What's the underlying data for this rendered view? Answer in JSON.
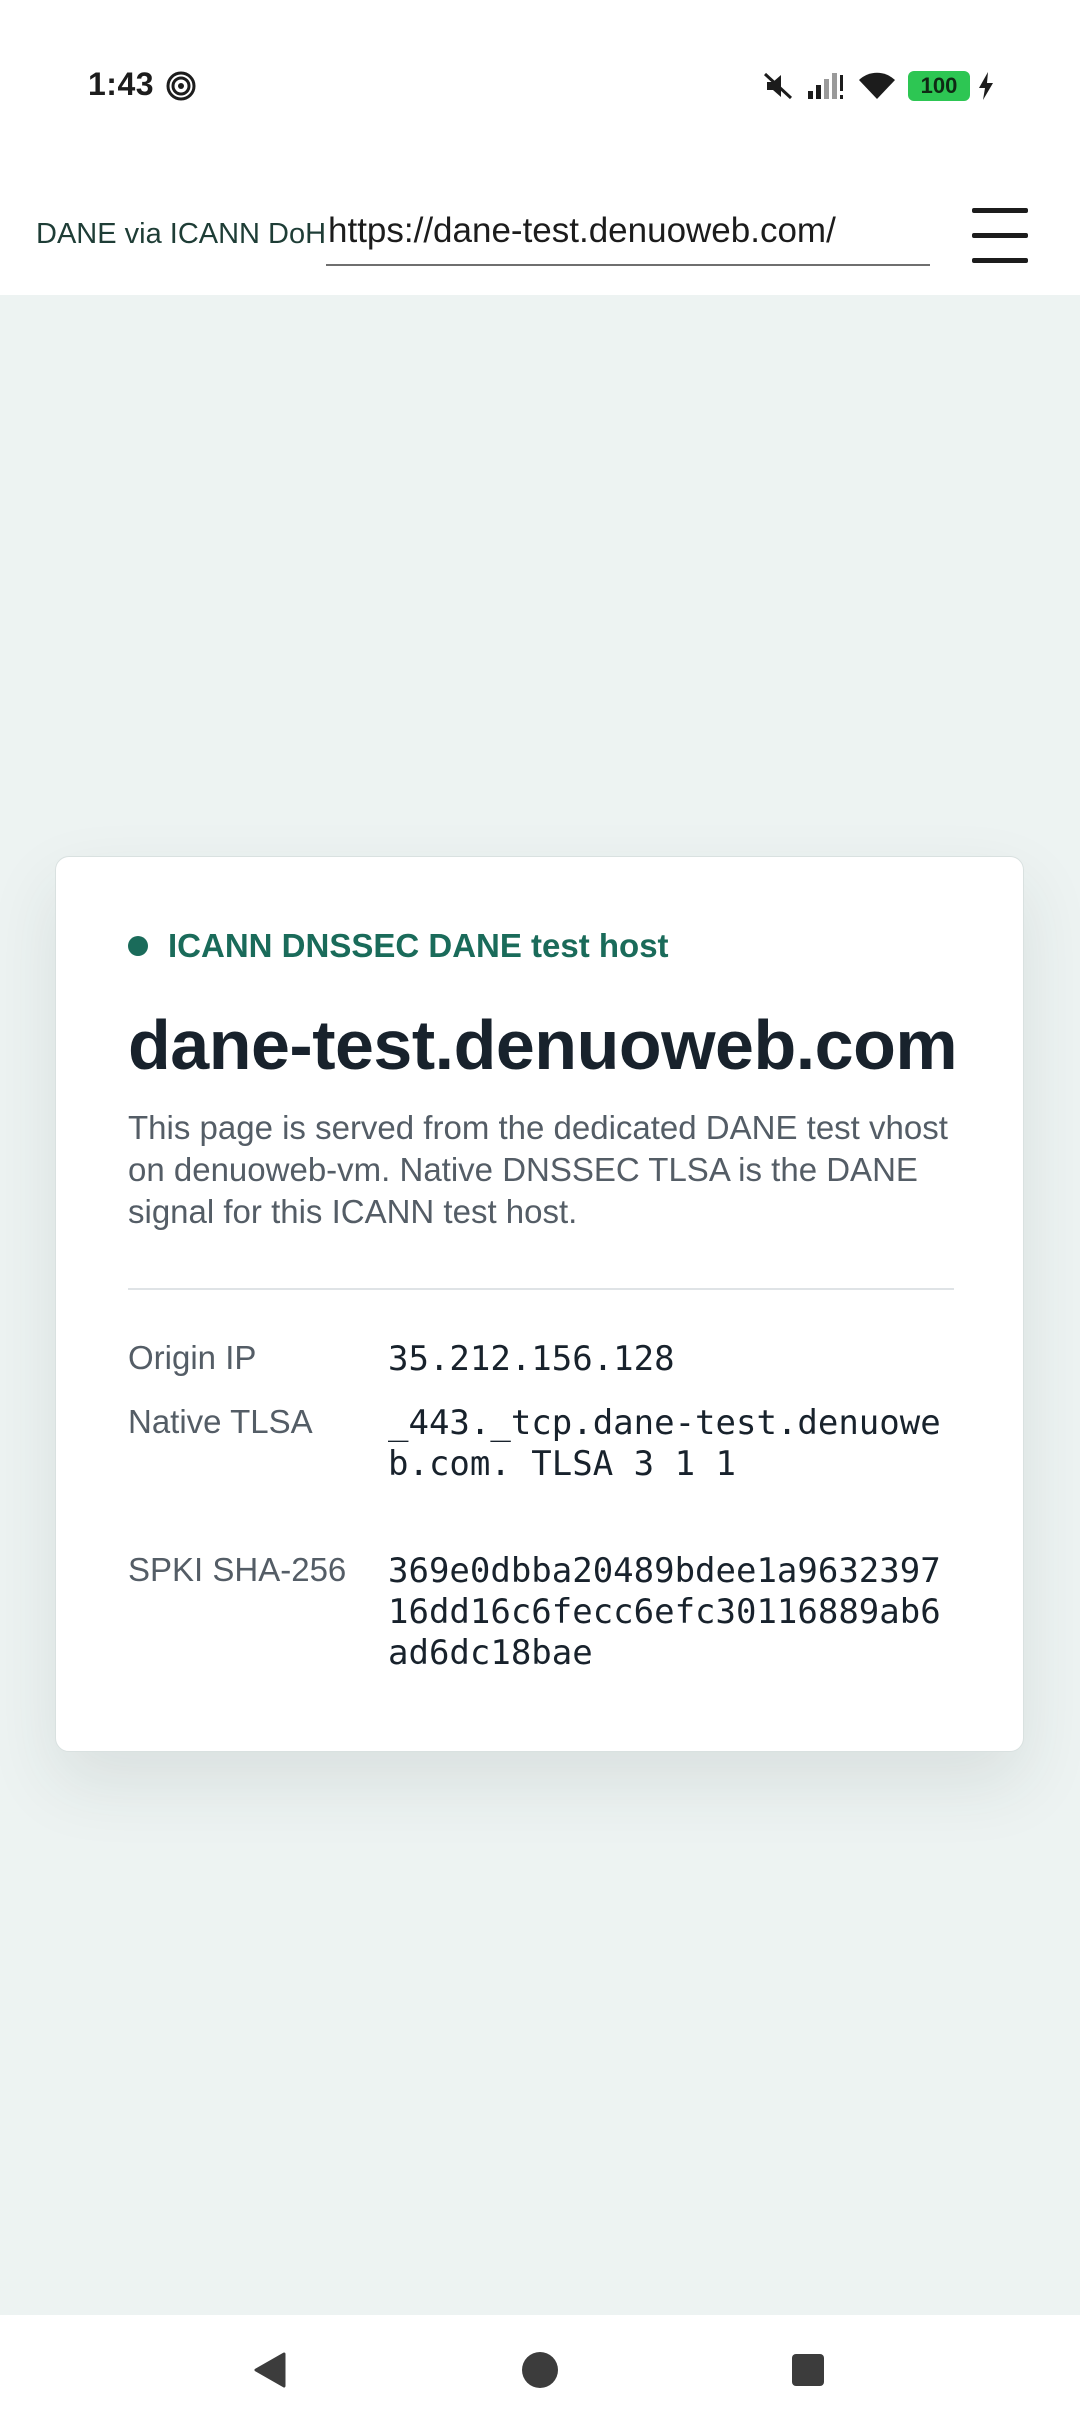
{
  "status_bar": {
    "time": "1:43",
    "battery_level": "100",
    "icons": [
      "spiral-icon",
      "muted-icon",
      "signal-icon",
      "wifi-icon",
      "battery-icon",
      "charging-icon"
    ]
  },
  "toolbar": {
    "label": "DANE via ICANN DoH",
    "url": "https://dane-test.denuoweb.com/",
    "menu_icon": "hamburger-menu-icon"
  },
  "card": {
    "eyebrow": "ICANN DNSSEC DANE test host",
    "title": "dane-test.denuoweb.com",
    "description": "This page is served from the dedicated DANE test vhost on denuoweb-vm. Native DNSSEC TLSA is the DANE signal for this ICANN test host.",
    "details": [
      {
        "label": "Origin IP",
        "value": "35.212.156.128"
      },
      {
        "label": "Native TLSA",
        "value": "_443._tcp.dane-test.denuoweb.com. TLSA 3 1 1"
      },
      {
        "label": "SPKI SHA-256",
        "value": "369e0dbba20489bdee1a963239716dd16c6fecc6efc30116889ab6ad6dc18bae"
      }
    ]
  },
  "nav_bar": {
    "icons": [
      "back-icon",
      "home-icon",
      "recents-icon"
    ]
  },
  "colors": {
    "accent": "#1a6b5a",
    "page_background": "#edf3f2",
    "battery": "#2dc653"
  }
}
